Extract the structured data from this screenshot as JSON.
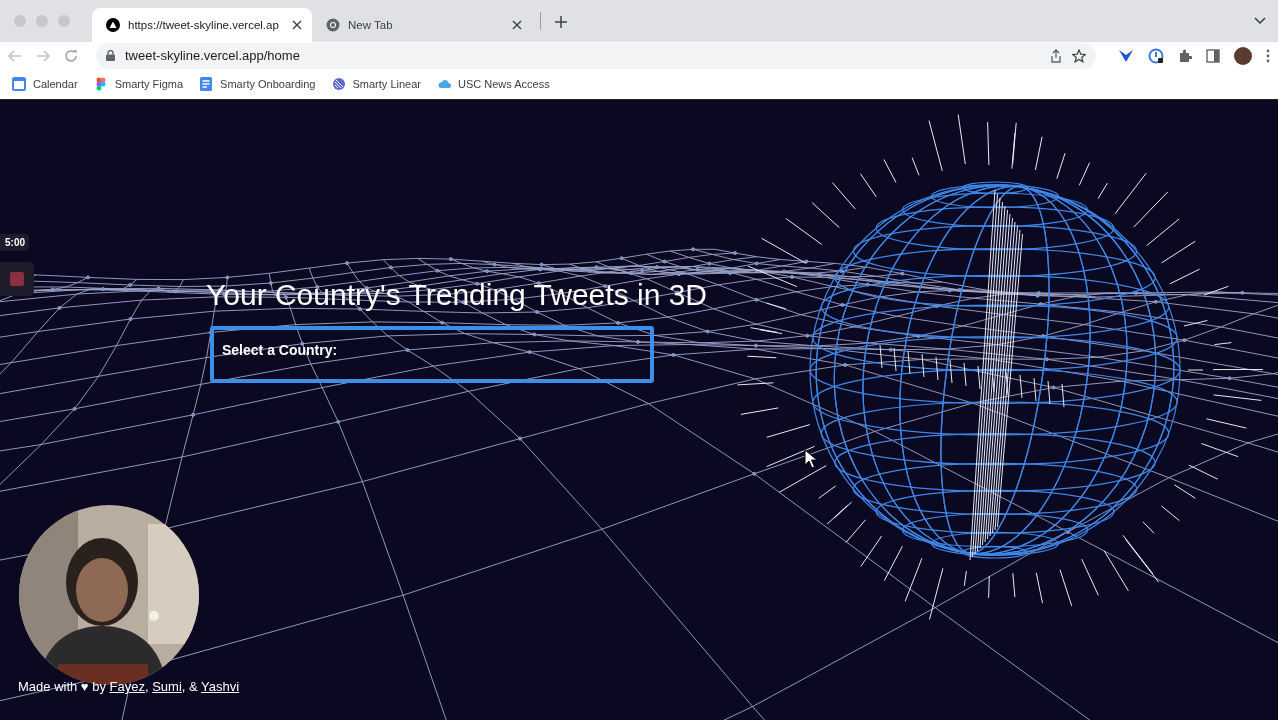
{
  "browser": {
    "tabs": [
      {
        "title": "https://tweet-skyline.vercel.ap",
        "selected": true
      },
      {
        "title": "New Tab",
        "selected": false
      }
    ],
    "address": "tweet-skyline.vercel.app/home",
    "bookmarks": [
      {
        "label": "Calendar",
        "kind": "calendar"
      },
      {
        "label": "Smarty Figma",
        "kind": "figma"
      },
      {
        "label": "Smarty Onboarding",
        "kind": "docs"
      },
      {
        "label": "Smarty Linear",
        "kind": "linear"
      },
      {
        "label": "USC News Access",
        "kind": "cloud"
      }
    ]
  },
  "recorder": {
    "time": "5:00"
  },
  "page": {
    "title": "Your Country's Trending Tweets in 3D",
    "select_label": "Select a Country:",
    "credits": [
      {
        "kind": "text",
        "text": "Made with ♥ by "
      },
      {
        "kind": "link",
        "text": "Fayez"
      },
      {
        "kind": "text",
        "text": ", "
      },
      {
        "kind": "link",
        "text": "Sumi"
      },
      {
        "kind": "text",
        "text": ", & "
      },
      {
        "kind": "link",
        "text": "Yashvi"
      }
    ]
  }
}
